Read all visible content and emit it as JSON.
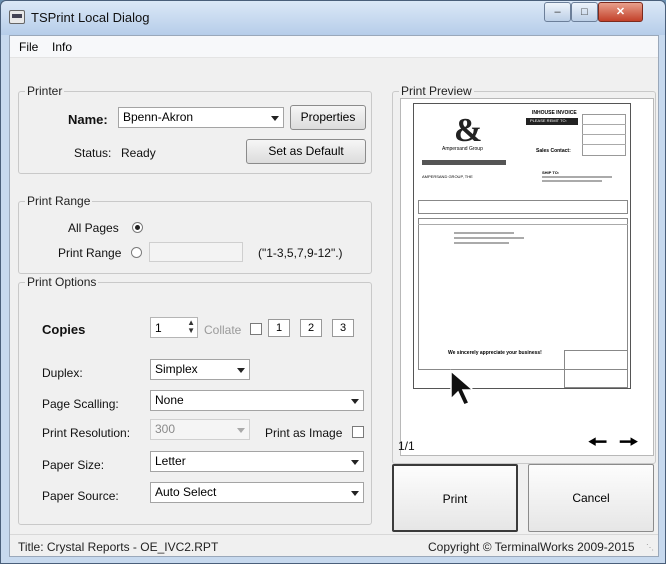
{
  "window": {
    "title": "TSPrint Local Dialog"
  },
  "menu": [
    "File",
    "Info"
  ],
  "printer": {
    "legend": "Printer",
    "name_label": "Name:",
    "name_value": "Bpenn-Akron",
    "properties_button": "Properties",
    "status_label": "Status:",
    "status_value": "Ready",
    "set_default_button": "Set as Default"
  },
  "range": {
    "legend": "Print Range",
    "all_pages_label": "All Pages",
    "print_range_label": "Print Range",
    "range_value": "",
    "range_hint": "(\"1-3,5,7,9-12\".)"
  },
  "options": {
    "legend": "Print Options",
    "copies_label": "Copies",
    "copies_value": "1",
    "collate_label": "Collate",
    "collate_icons": [
      "1",
      "2",
      "3"
    ],
    "duplex_label": "Duplex:",
    "duplex_value": "Simplex",
    "scaling_label": "Page Scalling:",
    "scaling_value": "None",
    "resolution_label": "Print Resolution:",
    "resolution_value": "300",
    "print_as_image_label": "Print as Image",
    "paper_size_label": "Paper Size:",
    "paper_size_value": "Letter",
    "paper_source_label": "Paper Source:",
    "paper_source_value": "Auto Select"
  },
  "preview": {
    "legend": "Print Preview",
    "page_indicator": "1/1",
    "doc": {
      "heading": "INHOUSE INVOICE",
      "please_remit": "PLEASE REMIT TO:",
      "company": "Ampersand Group",
      "sales_contact": "Sales Contact:",
      "ship_to": "SHIP TO:",
      "bill_to": "AMPERSAND GROUP, THE",
      "footer_note": "We sincerely appreciate your business!"
    }
  },
  "actions": {
    "print": "Print",
    "cancel": "Cancel"
  },
  "statusbar": {
    "left": "Title: Crystal Reports - OE_IVC2.RPT",
    "right": "Copyright © TerminalWorks 2009-2015"
  },
  "colors": {
    "title_bg": "#c7d9ee",
    "close_button": "#c3412a"
  }
}
